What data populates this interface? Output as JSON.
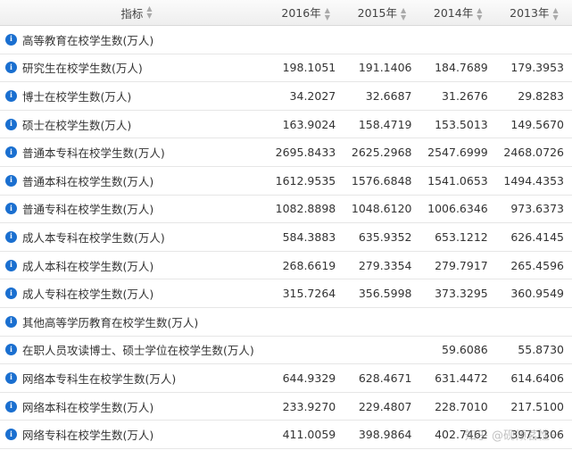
{
  "header": {
    "indicator": "指标",
    "years": [
      "2016年",
      "2015年",
      "2014年",
      "2013年"
    ]
  },
  "rows": [
    {
      "name": "高等教育在校学生数(万人)",
      "values": [
        "",
        "",
        "",
        ""
      ]
    },
    {
      "name": "研究生在校学生数(万人)",
      "values": [
        "198.1051",
        "191.1406",
        "184.7689",
        "179.3953"
      ]
    },
    {
      "name": "博士在校学生数(万人)",
      "values": [
        "34.2027",
        "32.6687",
        "31.2676",
        "29.8283"
      ]
    },
    {
      "name": "硕士在校学生数(万人)",
      "values": [
        "163.9024",
        "158.4719",
        "153.5013",
        "149.5670"
      ]
    },
    {
      "name": "普通本专科在校学生数(万人)",
      "values": [
        "2695.8433",
        "2625.2968",
        "2547.6999",
        "2468.0726"
      ]
    },
    {
      "name": "普通本科在校学生数(万人)",
      "values": [
        "1612.9535",
        "1576.6848",
        "1541.0653",
        "1494.4353"
      ]
    },
    {
      "name": "普通专科在校学生数(万人)",
      "values": [
        "1082.8898",
        "1048.6120",
        "1006.6346",
        "973.6373"
      ]
    },
    {
      "name": "成人本专科在校学生数(万人)",
      "values": [
        "584.3883",
        "635.9352",
        "653.1212",
        "626.4145"
      ]
    },
    {
      "name": "成人本科在校学生数(万人)",
      "values": [
        "268.6619",
        "279.3354",
        "279.7917",
        "265.4596"
      ]
    },
    {
      "name": "成人专科在校学生数(万人)",
      "values": [
        "315.7264",
        "356.5998",
        "373.3295",
        "360.9549"
      ]
    },
    {
      "name": "其他高等学历教育在校学生数(万人)",
      "values": [
        "",
        "",
        "",
        ""
      ]
    },
    {
      "name": "在职人员攻读博士、硕士学位在校学生数(万人)",
      "values": [
        "",
        "",
        "59.6086",
        "55.8730"
      ]
    },
    {
      "name": "网络本专科生在校学生数(万人)",
      "values": [
        "644.9329",
        "628.4671",
        "631.4472",
        "614.6406"
      ]
    },
    {
      "name": "网络本科在校学生数(万人)",
      "values": [
        "233.9270",
        "229.4807",
        "228.7010",
        "217.5100"
      ]
    },
    {
      "name": "网络专科在校学生数(万人)",
      "values": [
        "411.0059",
        "398.9864",
        "402.7462",
        "397.1306"
      ]
    }
  ],
  "watermark": "知乎 @砚倾茗性一",
  "icons": {
    "info": "i",
    "sort": "▲▼"
  },
  "colors": {
    "info": "#1a6fd0",
    "header_bg": "#eeeeee",
    "border": "#e6e6e6"
  }
}
